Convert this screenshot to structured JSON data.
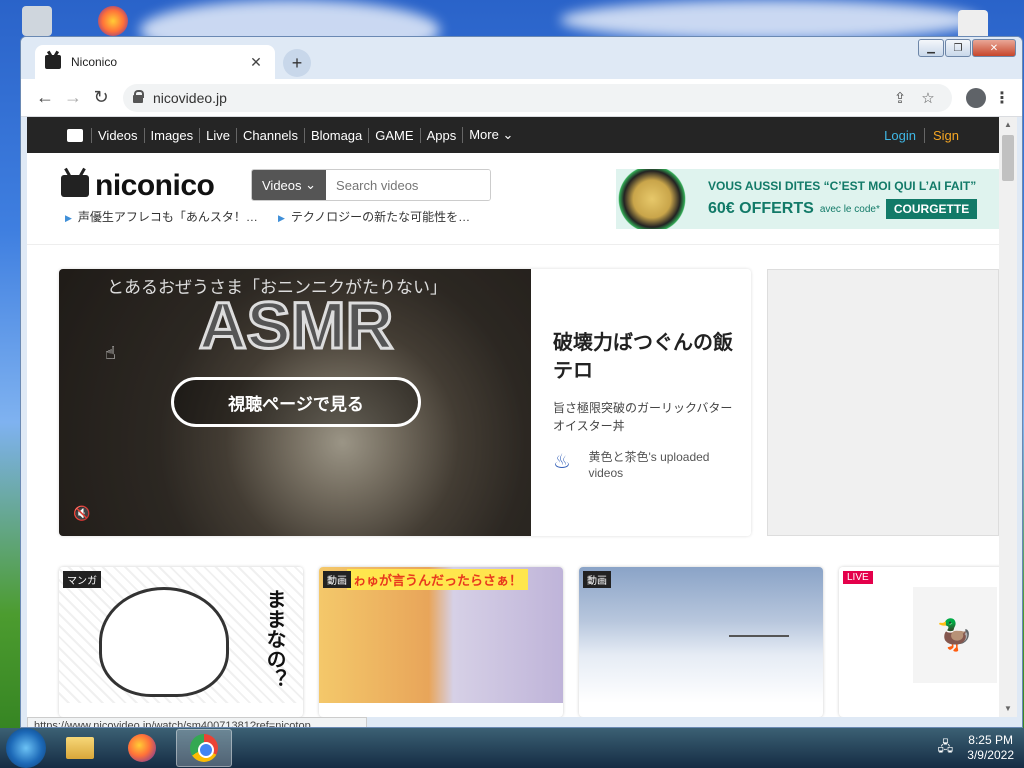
{
  "browser": {
    "tab_title": "Niconico",
    "url": "nicovideo.jp",
    "status_url": "https://www.nicovideo.jp/watch/sm40071381?ref=nicotop"
  },
  "nav": {
    "items": [
      "Videos",
      "Images",
      "Live",
      "Channels",
      "Blomaga",
      "GAME",
      "Apps",
      "More"
    ],
    "login": "Login",
    "signup": "Sign"
  },
  "header": {
    "brand": "niconico",
    "search_category": "Videos",
    "search_placeholder": "Search videos",
    "ticker": [
      "声優生アフレコも「あんスタ！…",
      "テクノロジーの新たな可能性を…"
    ]
  },
  "ad": {
    "headline": "VOUS AUSSI DITES “C’EST MOI QUI L’AI FAIT”",
    "offer": "60€ OFFERTS",
    "code_text": "avec le code*",
    "code": "COURGETTE"
  },
  "featured": {
    "caption": "とあるおぜうさま「おニンニクがたりない」",
    "overlay_title": "ASMR",
    "watch_button": "視聴ページで見る",
    "title": "破壊力ばつぐんの飯テロ",
    "description": "旨さ極限突破のガーリックバターオイスター丼",
    "uploader": "黄色と茶色's uploaded videos"
  },
  "cards": [
    {
      "badge": "マンガ",
      "thumb_text": "ままなの？"
    },
    {
      "badge": "動画",
      "thumb_text": "ゎゅが言うんだったらさぁ！"
    },
    {
      "badge": "動画"
    },
    {
      "badge": "LIVE"
    }
  ],
  "taskbar": {
    "time": "8:25 PM",
    "date": "3/9/2022"
  },
  "colors": {
    "nav_bg": "#252525",
    "login": "#3fb7e5",
    "signup": "#f5a623",
    "ad_green": "#127a68",
    "live_badge": "#e4004b"
  }
}
